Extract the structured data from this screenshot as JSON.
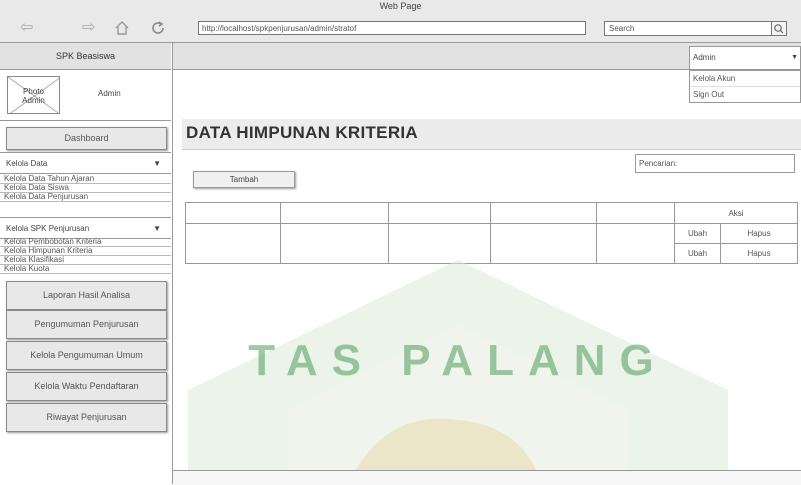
{
  "window": {
    "title": "Web Page"
  },
  "browser": {
    "url": "http://localhost/spkpenjurusan/admin/stratof",
    "search_placeholder": "Search"
  },
  "sidebar": {
    "brand": "SPK Beasiswa",
    "photo_label": "Photo\nAdmin",
    "profile_name": "Admin",
    "dashboard": "Dashboard",
    "kelola_data": {
      "label": "Kelola Data",
      "items": [
        "Kelola Data Tahun Ajaran",
        "Kelola Data Siswa",
        "Kelola Data Penjurusan"
      ]
    },
    "kelola_spk": {
      "label": "Kelola SPK Penjurusan",
      "items": [
        "Kelola Pembobotan Kriteria",
        "Kelola Himpunan Kriteria",
        "Kelola Klasifikasi",
        "Kelola Kuota"
      ]
    },
    "buttons": [
      "Laporan Hasil Analisa",
      "Pengumuman Penjurusan",
      "Kelola Pengumuman Umum",
      "Kelola Waktu Pendaftaran",
      "Riwayat Penjurusan"
    ]
  },
  "topbar": {
    "user": "Admin",
    "menu": [
      "Kelola Akun",
      "Sign Out"
    ]
  },
  "main": {
    "title": "DATA HIMPUNAN KRITERIA",
    "add_button": "Tambah",
    "search_label": "Pencarian:",
    "table": {
      "header_action": "Aksi",
      "rows": [
        {
          "edit": "Ubah",
          "delete": "Hapus"
        },
        {
          "edit": "Ubah",
          "delete": "Hapus"
        }
      ]
    }
  },
  "watermark": {
    "text": "TAS PALANG"
  },
  "colors": {
    "chrome": "#e9e9e9",
    "panel": "#e2e2e2",
    "watermark": "#2e8b3e"
  }
}
